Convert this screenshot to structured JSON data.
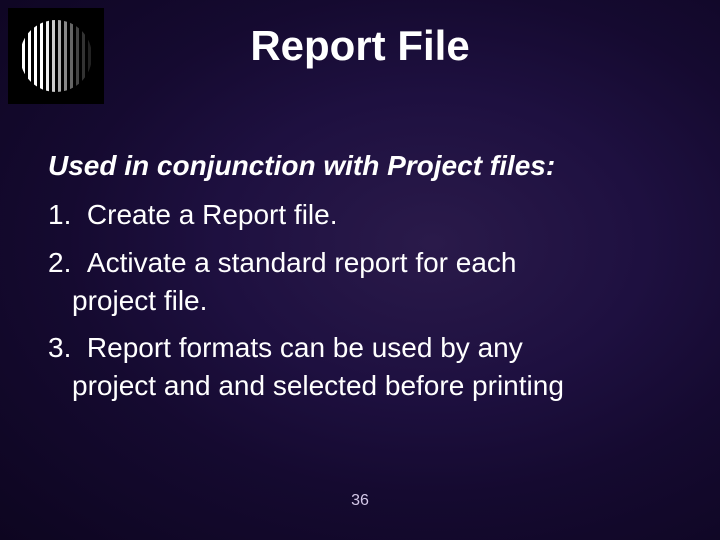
{
  "title": "Report File",
  "subtitle": "Used in conjunction with Project files:",
  "items": [
    {
      "num": "1.",
      "text": "Create a Report file."
    },
    {
      "num": "2.",
      "text": "Activate a standard report for each",
      "cont": "project file."
    },
    {
      "num": "3.",
      "text": "Report formats can be used by any",
      "cont": "project and and selected before printing"
    }
  ],
  "page_number": "36",
  "logo_icon": "vertical-blinds-circle"
}
